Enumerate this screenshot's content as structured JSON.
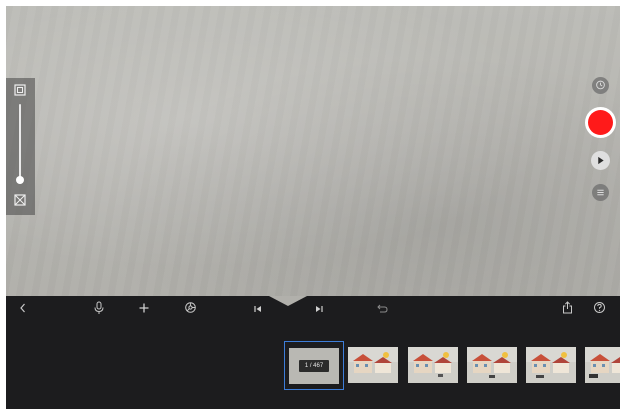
{
  "filmstrip": {
    "counter": "1 / 467",
    "thumbnails": [
      "frame-thumbnail",
      "frame-thumbnail",
      "frame-thumbnail",
      "frame-thumbnail",
      "frame-thumbnail"
    ]
  },
  "icons": {
    "zoom_in": "zoom-in-icon",
    "zoom_out": "zoom-out-icon",
    "timer": "timer-icon",
    "record": "record-icon",
    "play": "play-icon",
    "menu": "menu-icon",
    "back": "chevron-left-icon",
    "microphone": "microphone-icon",
    "add": "plus-icon",
    "settings": "settings-icon",
    "previous_frame": "skip-back-icon",
    "next_frame": "skip-forward-icon",
    "undo": "undo-icon",
    "share": "share-icon",
    "help": "help-icon"
  },
  "colors": {
    "record": "#ff1a1a",
    "selection": "#3d7dd8",
    "toolbar": "#1c1c1e"
  }
}
